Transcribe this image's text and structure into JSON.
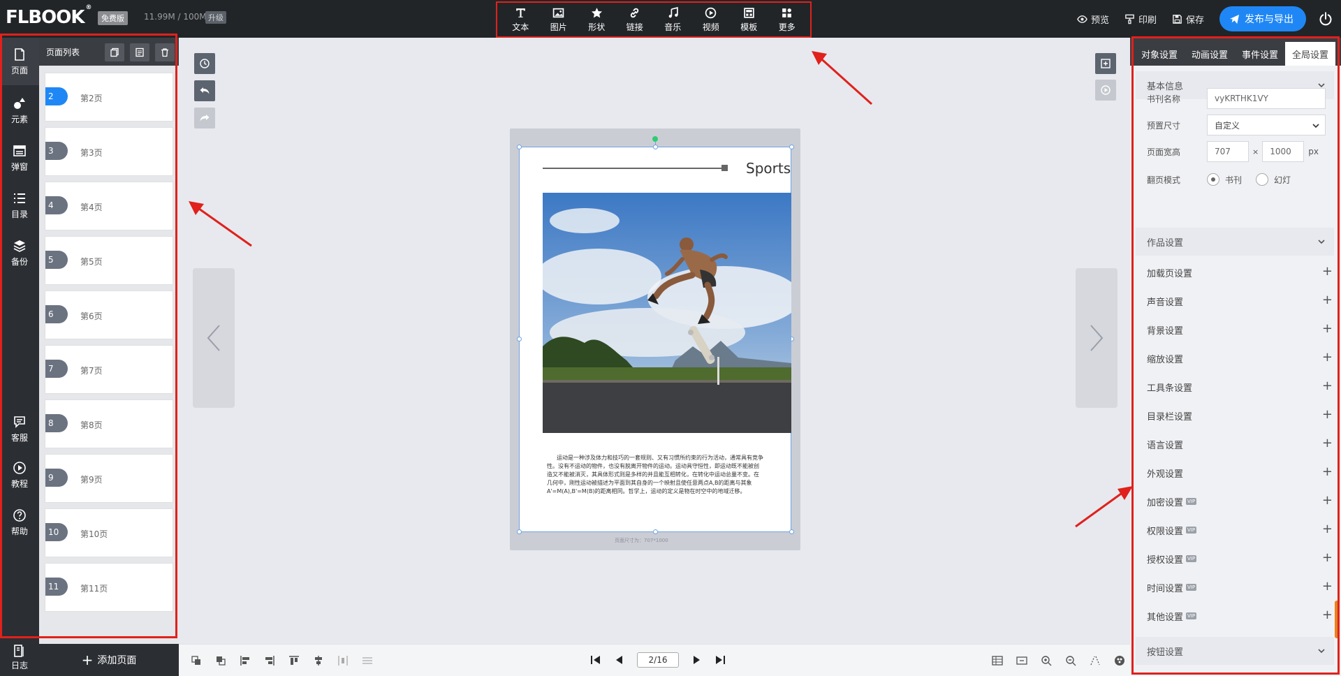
{
  "header": {
    "logo": "FLBOOK",
    "edition_badge": "免费版",
    "storage": "11.99M / 100M",
    "upgrade": "升级",
    "tools": [
      {
        "label": "文本",
        "icon": "text-icon"
      },
      {
        "label": "图片",
        "icon": "image-icon"
      },
      {
        "label": "形状",
        "icon": "star-icon"
      },
      {
        "label": "链接",
        "icon": "link-icon"
      },
      {
        "label": "音乐",
        "icon": "music-icon"
      },
      {
        "label": "视频",
        "icon": "video-icon"
      },
      {
        "label": "模板",
        "icon": "template-icon"
      },
      {
        "label": "更多",
        "icon": "more-icon"
      }
    ],
    "preview": "预览",
    "print": "印刷",
    "save": "保存",
    "publish": "发布与导出"
  },
  "leftnav": {
    "items": [
      {
        "label": "页面",
        "icon": "page-icon"
      },
      {
        "label": "元素",
        "icon": "elements-icon"
      },
      {
        "label": "弹窗",
        "icon": "popup-icon"
      },
      {
        "label": "目录",
        "icon": "list-icon"
      },
      {
        "label": "备份",
        "icon": "layers-icon"
      },
      {
        "label": "客服",
        "icon": "chat-icon"
      },
      {
        "label": "教程",
        "icon": "play-circle-icon"
      },
      {
        "label": "帮助",
        "icon": "help-icon"
      },
      {
        "label": "日志",
        "icon": "log-icon"
      }
    ]
  },
  "pagepanel": {
    "title": "页面列表",
    "pages": [
      {
        "num": "2",
        "label": "第2页",
        "active": true
      },
      {
        "num": "3",
        "label": "第3页"
      },
      {
        "num": "4",
        "label": "第4页"
      },
      {
        "num": "5",
        "label": "第5页"
      },
      {
        "num": "6",
        "label": "第6页"
      },
      {
        "num": "7",
        "label": "第7页"
      },
      {
        "num": "8",
        "label": "第8页"
      },
      {
        "num": "9",
        "label": "第9页"
      },
      {
        "num": "10",
        "label": "第10页"
      },
      {
        "num": "11",
        "label": "第11页"
      }
    ],
    "add_page": "添加页面"
  },
  "canvas": {
    "page_title": "Sports",
    "body_text": "运动是一种涉及体力和技巧的一套规则、又有习惯所约束的行为活动，通常具有竞争性。没有不运动的物件，也没有脱离开物件的运动。运动具守恒性，即运动既不能被创造又不能被消灭，其具体形式则是多样的并且能互相转化，在转化中运动总量不变。在几何中，刚性运动被描述为平面到其自身的一个映射且使任意两点A,B的距离与其象A'=M(A),B'=M(B)的距离相同。哲学上，运动的定义是物在时空中的地域迁移。",
    "size_note": "页面尺寸为：707*1000"
  },
  "pager": {
    "current": "2/16"
  },
  "rightpanel": {
    "tabs": [
      "对象设置",
      "动画设置",
      "事件设置",
      "全局设置"
    ],
    "active_tab": 3,
    "basic_info": {
      "title": "基本信息",
      "book_name_label": "书刊名称",
      "book_name_value": "vyKRTHK1VY",
      "preset_size_label": "预置尺寸",
      "preset_size_value": "自定义",
      "page_size_label": "页面宽高",
      "width": "707",
      "height": "1000",
      "times": "×",
      "unit": "px",
      "flip_mode_label": "翻页模式",
      "mode_book": "书刊",
      "mode_slide": "幻灯"
    },
    "work_settings": {
      "title": "作品设置",
      "items": [
        {
          "label": "加载页设置",
          "vip": false
        },
        {
          "label": "声音设置",
          "vip": false
        },
        {
          "label": "背景设置",
          "vip": false
        },
        {
          "label": "缩放设置",
          "vip": false
        },
        {
          "label": "工具条设置",
          "vip": false
        },
        {
          "label": "目录栏设置",
          "vip": false
        },
        {
          "label": "语言设置",
          "vip": false
        },
        {
          "label": "外观设置",
          "vip": false
        },
        {
          "label": "加密设置",
          "vip": true
        },
        {
          "label": "权限设置",
          "vip": true
        },
        {
          "label": "授权设置",
          "vip": true
        },
        {
          "label": "时间设置",
          "vip": true
        },
        {
          "label": "其他设置",
          "vip": true
        }
      ]
    },
    "button_settings": {
      "title": "按钮设置"
    },
    "vip_label": "VIP"
  },
  "colors": {
    "accent": "#1f87f5",
    "highlight_red": "#e0211c",
    "topbar": "#222528"
  }
}
